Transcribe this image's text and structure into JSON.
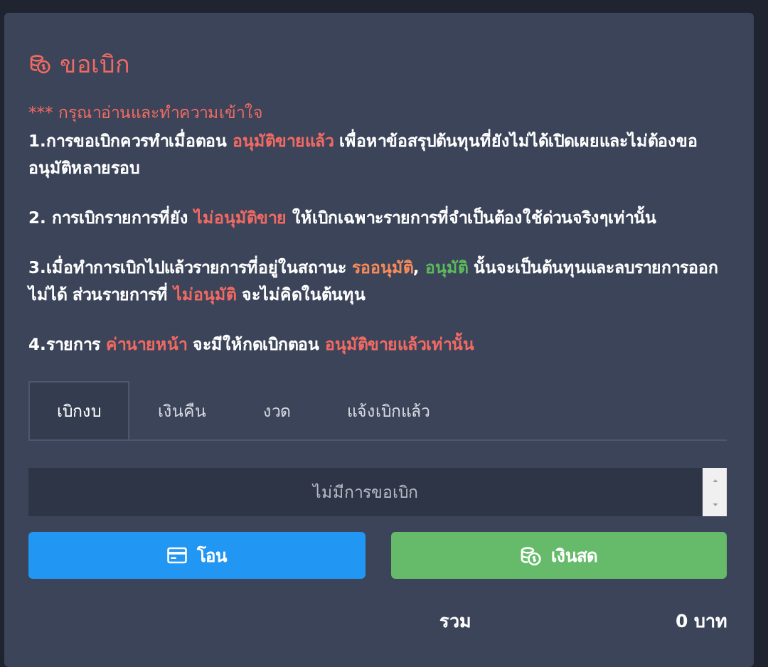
{
  "dialog": {
    "title": "ขอเบิก"
  },
  "notice": {
    "heading": "*** กรุณาอ่านและทำความเข้าใจ",
    "paragraphs": [
      [
        {
          "text": "1.การขอเบิกควรทำเมื่อตอน "
        },
        {
          "text": "อนุมัติขายแล้ว",
          "color": "#f06a63"
        },
        {
          "text": " เพื่อหาข้อสรุปต้นทุนที่ยังไม่ได้เปิดเผยและไม่ต้องขออนุมัติหลายรอบ"
        }
      ],
      [
        {
          "text": "2. การเบิกรายการที่ยัง "
        },
        {
          "text": "ไม่อนุมัติขาย",
          "color": "#f06a63"
        },
        {
          "text": " ให้เบิกเฉพาะรายการที่จำเป็นต้องใช้ด่วนจริงๆเท่านั้น"
        }
      ],
      [
        {
          "text": "3.เมื่อทำการเบิกไปแล้วรายการที่อยู่ในสถานะ "
        },
        {
          "text": "รออนุมัติ",
          "color": "#f58a5a"
        },
        {
          "text": ", "
        },
        {
          "text": "อนุมัติ",
          "color": "#5cb85c"
        },
        {
          "text": " นั้นจะเป็นต้นทุนและลบรายการออกไม่ได้ ส่วนรายการที่ "
        },
        {
          "text": "ไม่อนุมัติ",
          "color": "#f06a63"
        },
        {
          "text": " จะไม่คิดในต้นทุน"
        }
      ],
      [
        {
          "text": "4.รายการ "
        },
        {
          "text": "ค่านายหน้า",
          "color": "#f06a63"
        },
        {
          "text": " จะมีให้กดเบิกตอน "
        },
        {
          "text": "อนุมัติขายแล้วเท่านั้น",
          "color": "#f06a63"
        }
      ]
    ]
  },
  "tabs": [
    {
      "label": "เบิกงบ",
      "selected": true
    },
    {
      "label": "เงินคืน",
      "selected": false
    },
    {
      "label": "งวด",
      "selected": false
    },
    {
      "label": "แจ้งเบิกแล้ว",
      "selected": false
    }
  ],
  "list": {
    "empty_text": "ไม่มีการขอเบิก"
  },
  "buttons": [
    {
      "kind": "transfer",
      "label": "โอน"
    },
    {
      "kind": "cash",
      "label": "เงินสด"
    }
  ],
  "total": {
    "label": "รวม",
    "value": "0 บาท"
  }
}
